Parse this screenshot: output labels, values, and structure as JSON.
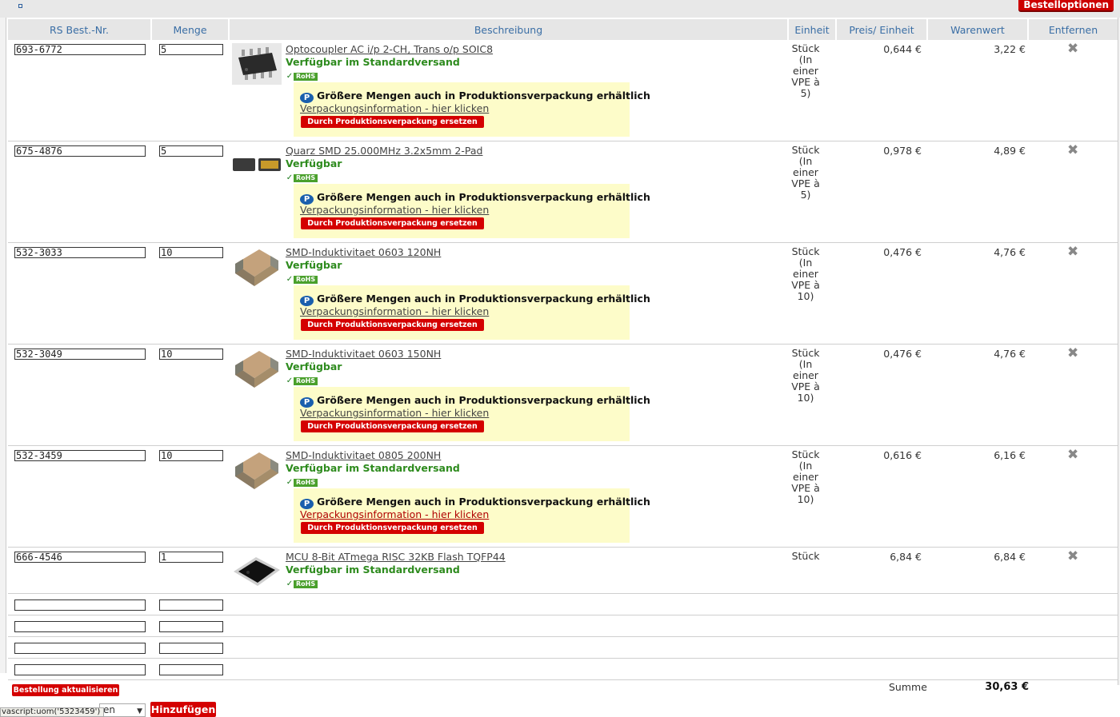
{
  "header": {
    "options_button": "Bestelloptionen"
  },
  "columns": {
    "nr": "RS Best.-Nr.",
    "qty": "Menge",
    "desc": "Beschreibung",
    "unit": "Einheit",
    "price": "Preis/ Einheit",
    "total": "Warenwert",
    "remove": "Entfernen"
  },
  "rows": [
    {
      "nr": "693-6772",
      "qty": "5",
      "title": "Optocoupler AC i/p 2-CH, Trans o/p SOIC8",
      "availability": "Verfügbar im Standardversand",
      "rohs": "RoHS",
      "prod_title": "Größere Mengen auch in Produktionsverpackung erhältlich",
      "prod_link": "Verpackungsinformation - hier klicken",
      "prod_button": "Durch Produktionsverpackung ersetzen",
      "unit_lines": [
        "Stück",
        "(In",
        "einer",
        "VPE à",
        "5)"
      ],
      "price": "0,644 €",
      "total": "3,22 €",
      "image": "soic8-chip"
    },
    {
      "nr": "675-4876",
      "qty": "5",
      "title": "Quarz SMD 25.000MHz 3.2x5mm 2-Pad",
      "availability": "Verfügbar",
      "rohs": "RoHS",
      "prod_title": "Größere Mengen auch in Produktionsverpackung erhältlich",
      "prod_link": "Verpackungsinformation - hier klicken",
      "prod_button": "Durch Produktionsverpackung ersetzen",
      "unit_lines": [
        "Stück",
        "(In",
        "einer",
        "VPE à",
        "5)"
      ],
      "price": "0,978 €",
      "total": "4,89 €",
      "image": "crystal"
    },
    {
      "nr": "532-3033",
      "qty": "10",
      "title": "SMD-Induktivitaet 0603 120NH",
      "availability": "Verfügbar",
      "rohs": "RoHS",
      "prod_title": "Größere Mengen auch in Produktionsverpackung erhältlich",
      "prod_link": "Verpackungsinformation - hier klicken",
      "prod_button": "Durch Produktionsverpackung ersetzen",
      "unit_lines": [
        "Stück",
        "(In",
        "einer",
        "VPE à",
        "10)"
      ],
      "price": "0,476 €",
      "total": "4,76 €",
      "image": "inductor"
    },
    {
      "nr": "532-3049",
      "qty": "10",
      "title": "SMD-Induktivitaet 0603 150NH",
      "availability": "Verfügbar",
      "rohs": "RoHS",
      "prod_title": "Größere Mengen auch in Produktionsverpackung erhältlich",
      "prod_link": "Verpackungsinformation - hier klicken",
      "prod_button": "Durch Produktionsverpackung ersetzen",
      "unit_lines": [
        "Stück",
        "(In",
        "einer",
        "VPE à",
        "10)"
      ],
      "price": "0,476 €",
      "total": "4,76 €",
      "image": "inductor"
    },
    {
      "nr": "532-3459",
      "qty": "10",
      "title": "SMD-Induktivitaet 0805 200NH",
      "availability": "Verfügbar im Standardversand",
      "rohs": "RoHS",
      "prod_title": "Größere Mengen auch in Produktionsverpackung erhältlich",
      "prod_link": "Verpackungsinformation - hier klicken",
      "prod_button": "Durch Produktionsverpackung ersetzen",
      "unit_lines": [
        "Stück",
        "(In",
        "einer",
        "VPE à",
        "10)"
      ],
      "price": "0,616 €",
      "total": "6,16 €",
      "image": "inductor"
    },
    {
      "nr": "666-4546",
      "qty": "1",
      "title": "MCU 8-Bit ATmega RISC 32KB Flash TQFP44",
      "availability": "Verfügbar im Standardversand",
      "rohs": "RoHS",
      "unit_lines": [
        "Stück"
      ],
      "price": "6,84 €",
      "total": "6,84 €",
      "image": "tqfp44-chip"
    }
  ],
  "footer": {
    "update_button": "Bestellung aktualisieren",
    "sum_label": "Summe",
    "sum_value": "30,63 €",
    "select_value": "en",
    "add_button": "Hinzufügen",
    "status_text": "vascript:uom('5323459')"
  }
}
